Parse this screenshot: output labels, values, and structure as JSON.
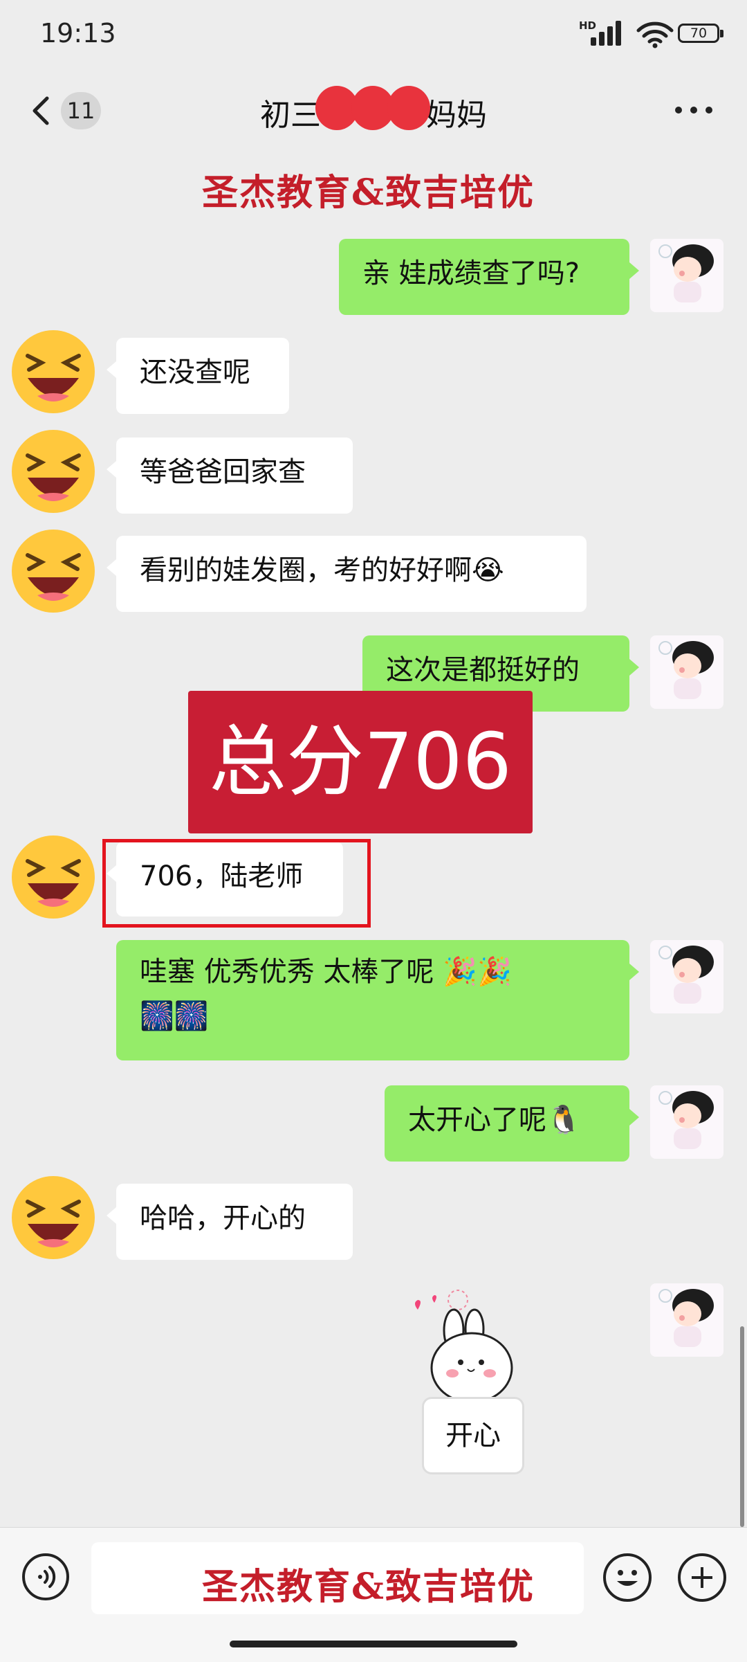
{
  "status_bar": {
    "time": "19:13",
    "network": "HD",
    "battery": "70"
  },
  "header": {
    "unread_count": "11",
    "title_prefix": "初三",
    "title_suffix": "妈妈"
  },
  "watermark": {
    "text": "圣杰教育&致吉培优"
  },
  "messages": [
    {
      "side": "out",
      "text": "亲 娃成绩查了吗?"
    },
    {
      "side": "in",
      "text": "还没查呢"
    },
    {
      "side": "in",
      "text": "等爸爸回家查"
    },
    {
      "side": "in",
      "text": "看别的娃发圈，考的好好啊😭"
    },
    {
      "side": "out",
      "text": "这次是都挺好的"
    },
    {
      "side": "in",
      "text": "706，陆老师"
    },
    {
      "side": "out",
      "text": "哇塞  优秀优秀  太棒了呢  🎉🎉"
    },
    {
      "side": "out",
      "text": "🎆🎆"
    },
    {
      "side": "out",
      "text": "太开心了呢🐧"
    },
    {
      "side": "in",
      "text": "哈哈，开心的"
    }
  ],
  "overlay": {
    "score_text": "总分706"
  },
  "sticker": {
    "label": "开心"
  },
  "input_bar": {
    "watermark_text": "圣杰教育&致吉培优"
  },
  "colors": {
    "accent_red": "#c81e34",
    "bubble_out": "#95ec69",
    "bubble_in": "#ffffff",
    "highlight": "#e3141e"
  }
}
